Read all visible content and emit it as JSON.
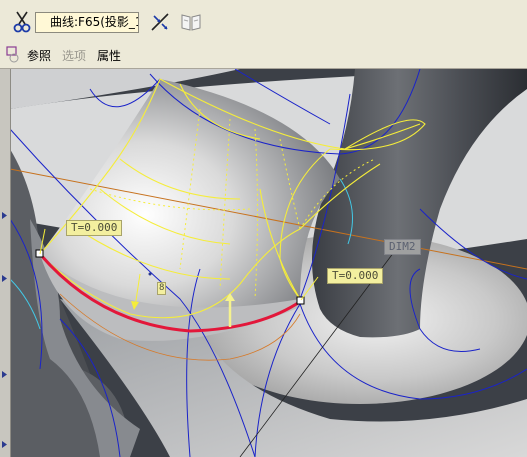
{
  "toolbar": {
    "curve_field_value": "曲线:F65(投影_1",
    "icons": [
      "scissors-icon",
      "flip-direction-icon",
      "book-icon"
    ]
  },
  "tabs": [
    {
      "label": "参照",
      "state": "active"
    },
    {
      "label": "选项",
      "state": "disabled"
    },
    {
      "label": "属性",
      "state": "active"
    }
  ],
  "viewport": {
    "t_label_left": "T=0.000",
    "t_label_right": "T=0.000",
    "dim_label": "DIM2",
    "small_marker": "8"
  },
  "colors": {
    "curve_highlight": "#e3173a",
    "preview_lines": "#f5ed3a",
    "edge_lines": "#1a23c9",
    "datum_line": "#c7721e"
  }
}
